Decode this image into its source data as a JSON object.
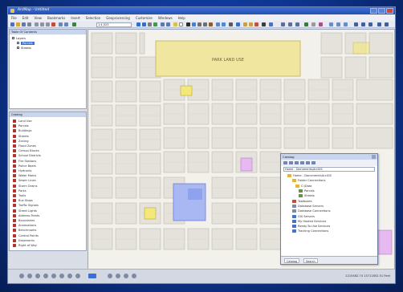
{
  "window": {
    "title": "ArcMap - Untitled",
    "controls": [
      "minimize-icon",
      "maximize-icon",
      "close-icon"
    ]
  },
  "menu": {
    "items": [
      "File",
      "Edit",
      "View",
      "Bookmarks",
      "Insert",
      "Selection",
      "Geoprocessing",
      "Customize",
      "Windows",
      "Help"
    ]
  },
  "toolbar": {
    "scale_value": "1:4,523"
  },
  "toc": {
    "title": "Table Of Contents",
    "root": "Layers",
    "layers": [
      {
        "label": "Parcels",
        "selected": true
      },
      {
        "label": "Streets",
        "selected": false
      }
    ]
  },
  "catalog_panel": {
    "title": "Catalog",
    "items": [
      "Land Use",
      "Parcels",
      "Buildings",
      "Streets",
      "Zoning",
      "Flood Zones",
      "Census Blocks",
      "School Districts",
      "Fire Stations",
      "Police Beats",
      "Hydrants",
      "Water Mains",
      "Sewer Lines",
      "Storm Drains",
      "Parks",
      "Trails",
      "Bus Stops",
      "Traffic Signals",
      "Street Lights",
      "Address Points",
      "Boundaries",
      "Annexations",
      "Benchmarks",
      "Control Points",
      "Easements",
      "Right of Way"
    ]
  },
  "map": {
    "label": "PARK LAND USE",
    "colors": {
      "background": "#f2f1ec",
      "blocks": "#e4e2da",
      "streets": "#c9c6bd",
      "park": "#f0e6a0",
      "selection": "#a9b8f2",
      "highlight_pink": "#e6b9f0",
      "highlight_yellow": "#f4e87a"
    }
  },
  "catalog_window": {
    "title": "Catalog",
    "location": "Home - Documents\\ArcGIS",
    "items": [
      "Home - Documents\\ArcGIS",
      "Folder Connections",
      "C:\\Data",
      "Parcels",
      "Streets",
      "Toolboxes",
      "Database Servers",
      "Database Connections",
      "GIS Servers",
      "My Hosted Services",
      "Ready-To-Use Services",
      "Tracking Connections"
    ],
    "tabs": [
      "Catalog",
      "Search"
    ]
  },
  "status": {
    "coordinates": "2215482.74 13711852.51 Feet"
  }
}
